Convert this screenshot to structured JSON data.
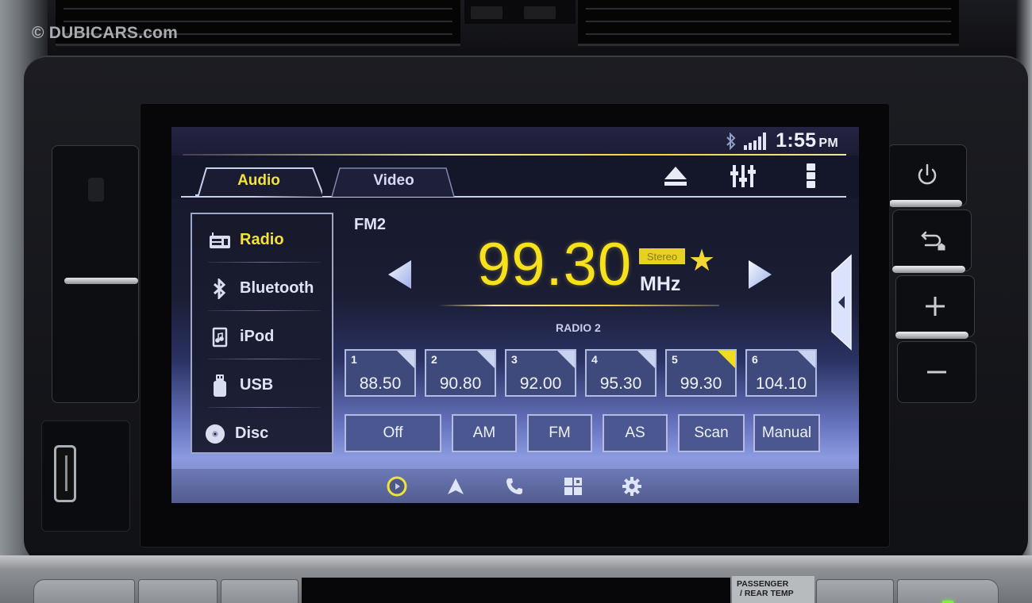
{
  "watermark": "© DUBICARS.com",
  "status": {
    "time": "1:55",
    "ampm": "PM",
    "icons": [
      "bluetooth-icon",
      "signal-icon"
    ]
  },
  "tabs": [
    {
      "label": "Audio",
      "active": true
    },
    {
      "label": "Video",
      "active": false
    }
  ],
  "toolbar": {
    "icons": [
      "eject-icon",
      "equalizer-icon",
      "more-menu-icon"
    ]
  },
  "sidebar": {
    "items": [
      {
        "label": "Radio",
        "icon": "radio-icon",
        "active": true
      },
      {
        "label": "Bluetooth",
        "icon": "bluetooth-icon",
        "active": false
      },
      {
        "label": "iPod",
        "icon": "ipod-icon",
        "active": false
      },
      {
        "label": "USB",
        "icon": "usb-icon",
        "active": false
      },
      {
        "label": "Disc",
        "icon": "disc-icon",
        "active": false
      }
    ]
  },
  "tuner": {
    "band": "FM2",
    "frequency": "99.30",
    "unit": "MHz",
    "stereo_badge": "Stereo",
    "favorite": "★",
    "station_name": "RADIO 2"
  },
  "presets": [
    {
      "num": "1",
      "freq": "88.50",
      "current": false
    },
    {
      "num": "2",
      "freq": "90.80",
      "current": false
    },
    {
      "num": "3",
      "freq": "92.00",
      "current": false
    },
    {
      "num": "4",
      "freq": "95.30",
      "current": false
    },
    {
      "num": "5",
      "freq": "99.30",
      "current": true
    },
    {
      "num": "6",
      "freq": "104.10",
      "current": false
    }
  ],
  "function_buttons": [
    "Off",
    "AM",
    "FM",
    "AS",
    "Scan",
    "Manual"
  ],
  "bottom_nav": {
    "icons": [
      "media-icon",
      "navigation-icon",
      "phone-icon",
      "apps-icon",
      "settings-icon"
    ],
    "active": "media-icon"
  },
  "hardware": {
    "right_buttons": [
      "power-icon",
      "back-home-icon",
      "volume-up-icon",
      "volume-down-icon"
    ],
    "climate_label_line1": "PASSENGER",
    "climate_label_line2": "/ REAR TEMP"
  },
  "colors": {
    "accent_yellow": "#f3e23a",
    "screen_dark": "#1a1d33",
    "screen_light": "#8c9ae0"
  }
}
